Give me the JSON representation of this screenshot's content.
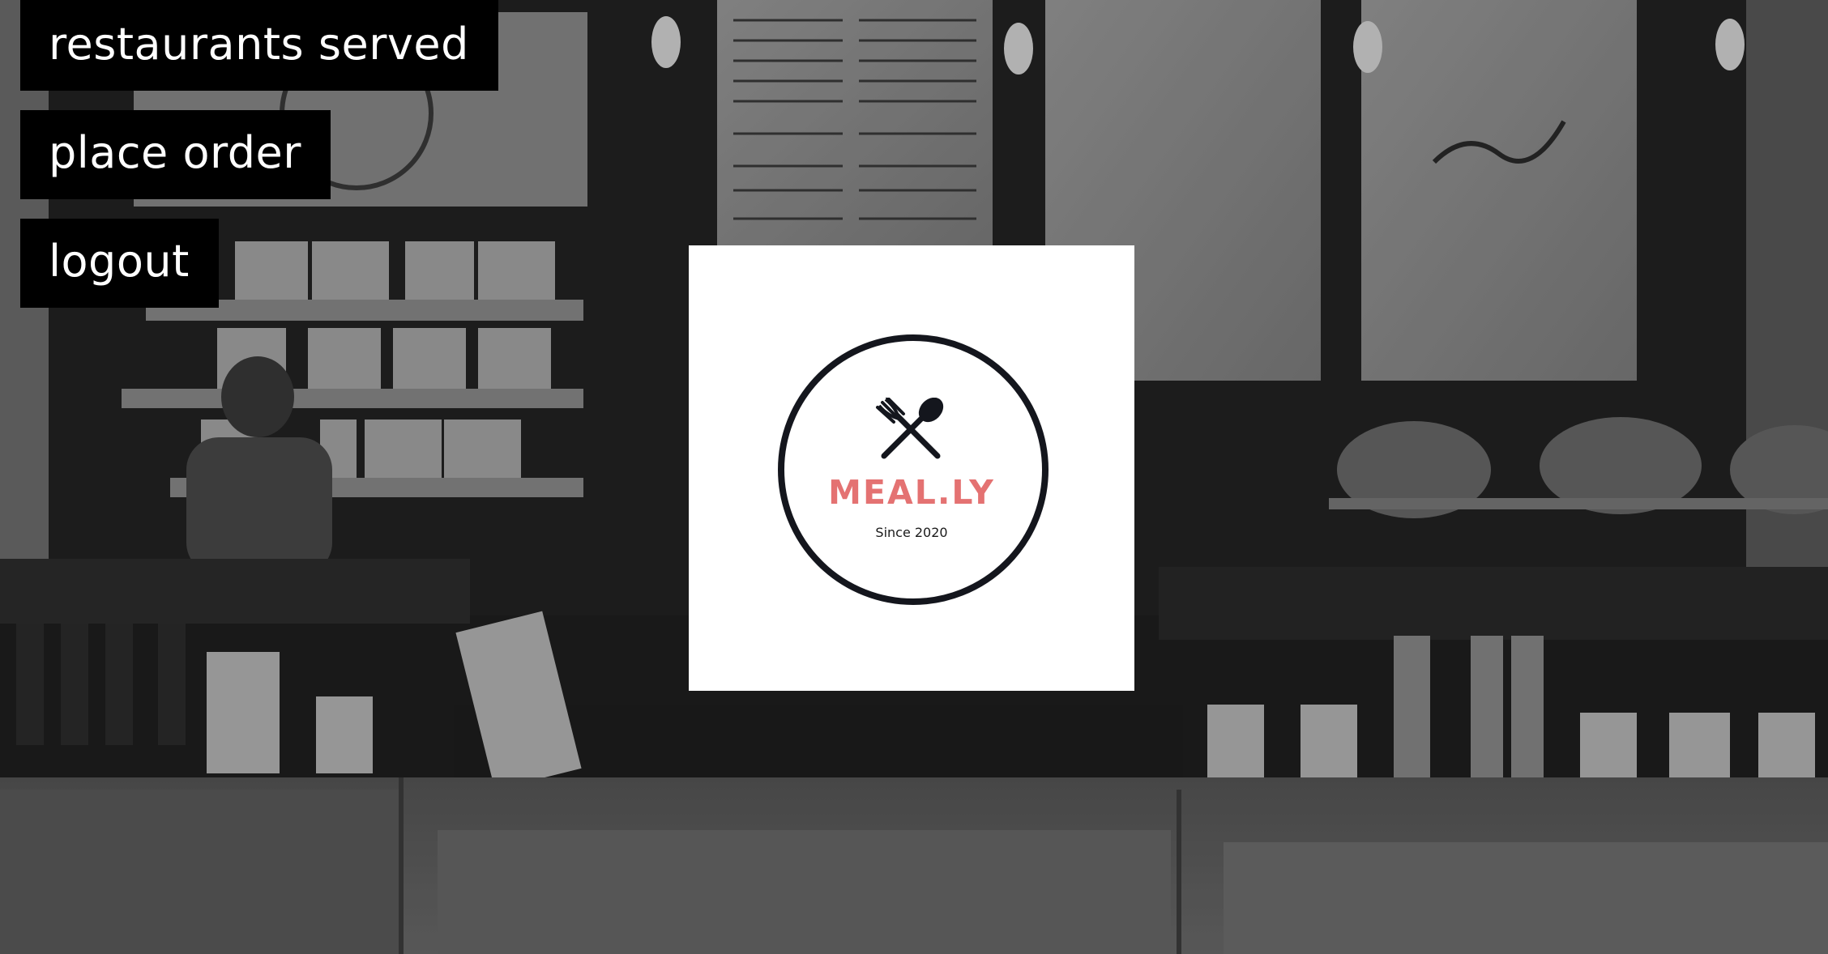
{
  "nav": {
    "restaurants_served": "restaurants served",
    "place_order": "place order",
    "logout": "logout"
  },
  "logo": {
    "brand": "MEAL.LY",
    "tagline": "Since 2020",
    "icon": "fork-spoon-crossed-icon",
    "brand_color": "#e47272",
    "ring_color": "#14161d"
  },
  "background": {
    "icon": "cafe-counter-photo",
    "tone": "grayscale-dimmed"
  }
}
